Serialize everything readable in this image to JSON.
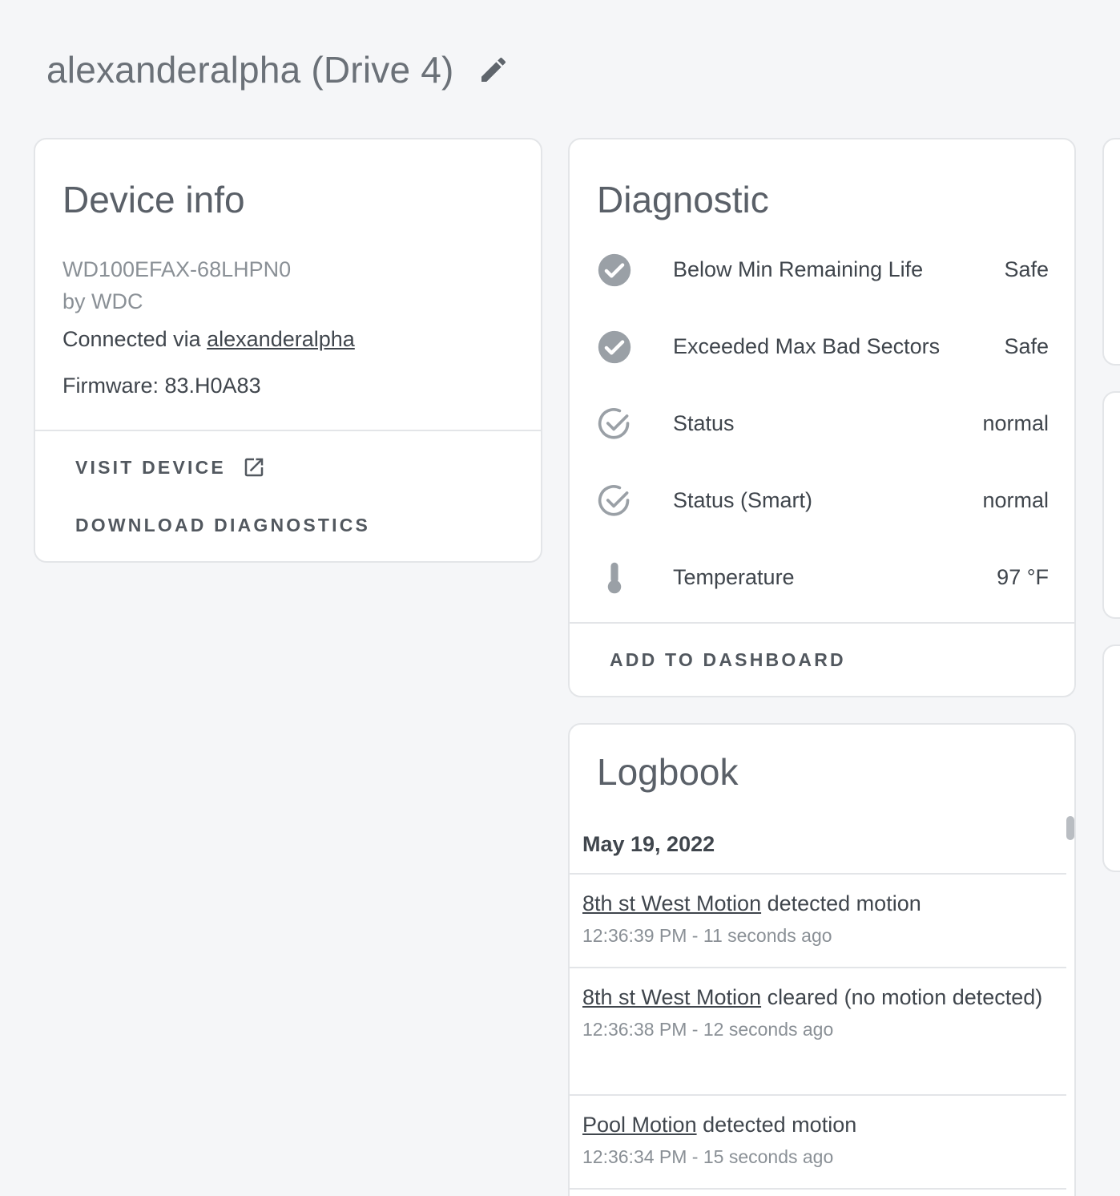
{
  "header": {
    "title": "alexanderalpha (Drive 4)"
  },
  "device_info": {
    "title": "Device info",
    "model": "WD100EFAX-68LHPN0",
    "manufacturer": "by WDC",
    "connected_prefix": "Connected via ",
    "connected_link": "alexanderalpha",
    "firmware": "Firmware: 83.H0A83",
    "visit_device": "VISIT DEVICE",
    "download_diagnostics": "DOWNLOAD DIAGNOSTICS"
  },
  "diagnostic": {
    "title": "Diagnostic",
    "rows": [
      {
        "icon": "check-circle-filled-icon",
        "label": "Below Min Remaining Life",
        "value": "Safe"
      },
      {
        "icon": "check-circle-filled-icon",
        "label": "Exceeded Max Bad Sectors",
        "value": "Safe"
      },
      {
        "icon": "check-circle-outline-icon",
        "label": "Status",
        "value": "normal"
      },
      {
        "icon": "check-circle-outline-icon",
        "label": "Status (Smart)",
        "value": "normal"
      },
      {
        "icon": "thermometer-icon",
        "label": "Temperature",
        "value": "97 °F"
      }
    ],
    "add_to_dashboard": "ADD TO DASHBOARD"
  },
  "logbook": {
    "title": "Logbook",
    "date": "May 19, 2022",
    "entries": [
      {
        "entity": "8th st West Motion",
        "message": " detected motion",
        "time": "12:36:39 PM - 11 seconds ago"
      },
      {
        "entity": "8th st West Motion",
        "message": " cleared (no motion detected)",
        "time": "12:36:38 PM - 12 seconds ago"
      },
      {
        "entity": "Pool Motion",
        "message": " detected motion",
        "time": "12:36:34 PM - 15 seconds ago"
      }
    ]
  },
  "colors": {
    "background": "#f5f6f8",
    "card": "#ffffff",
    "icon": "#9aa0a6"
  }
}
